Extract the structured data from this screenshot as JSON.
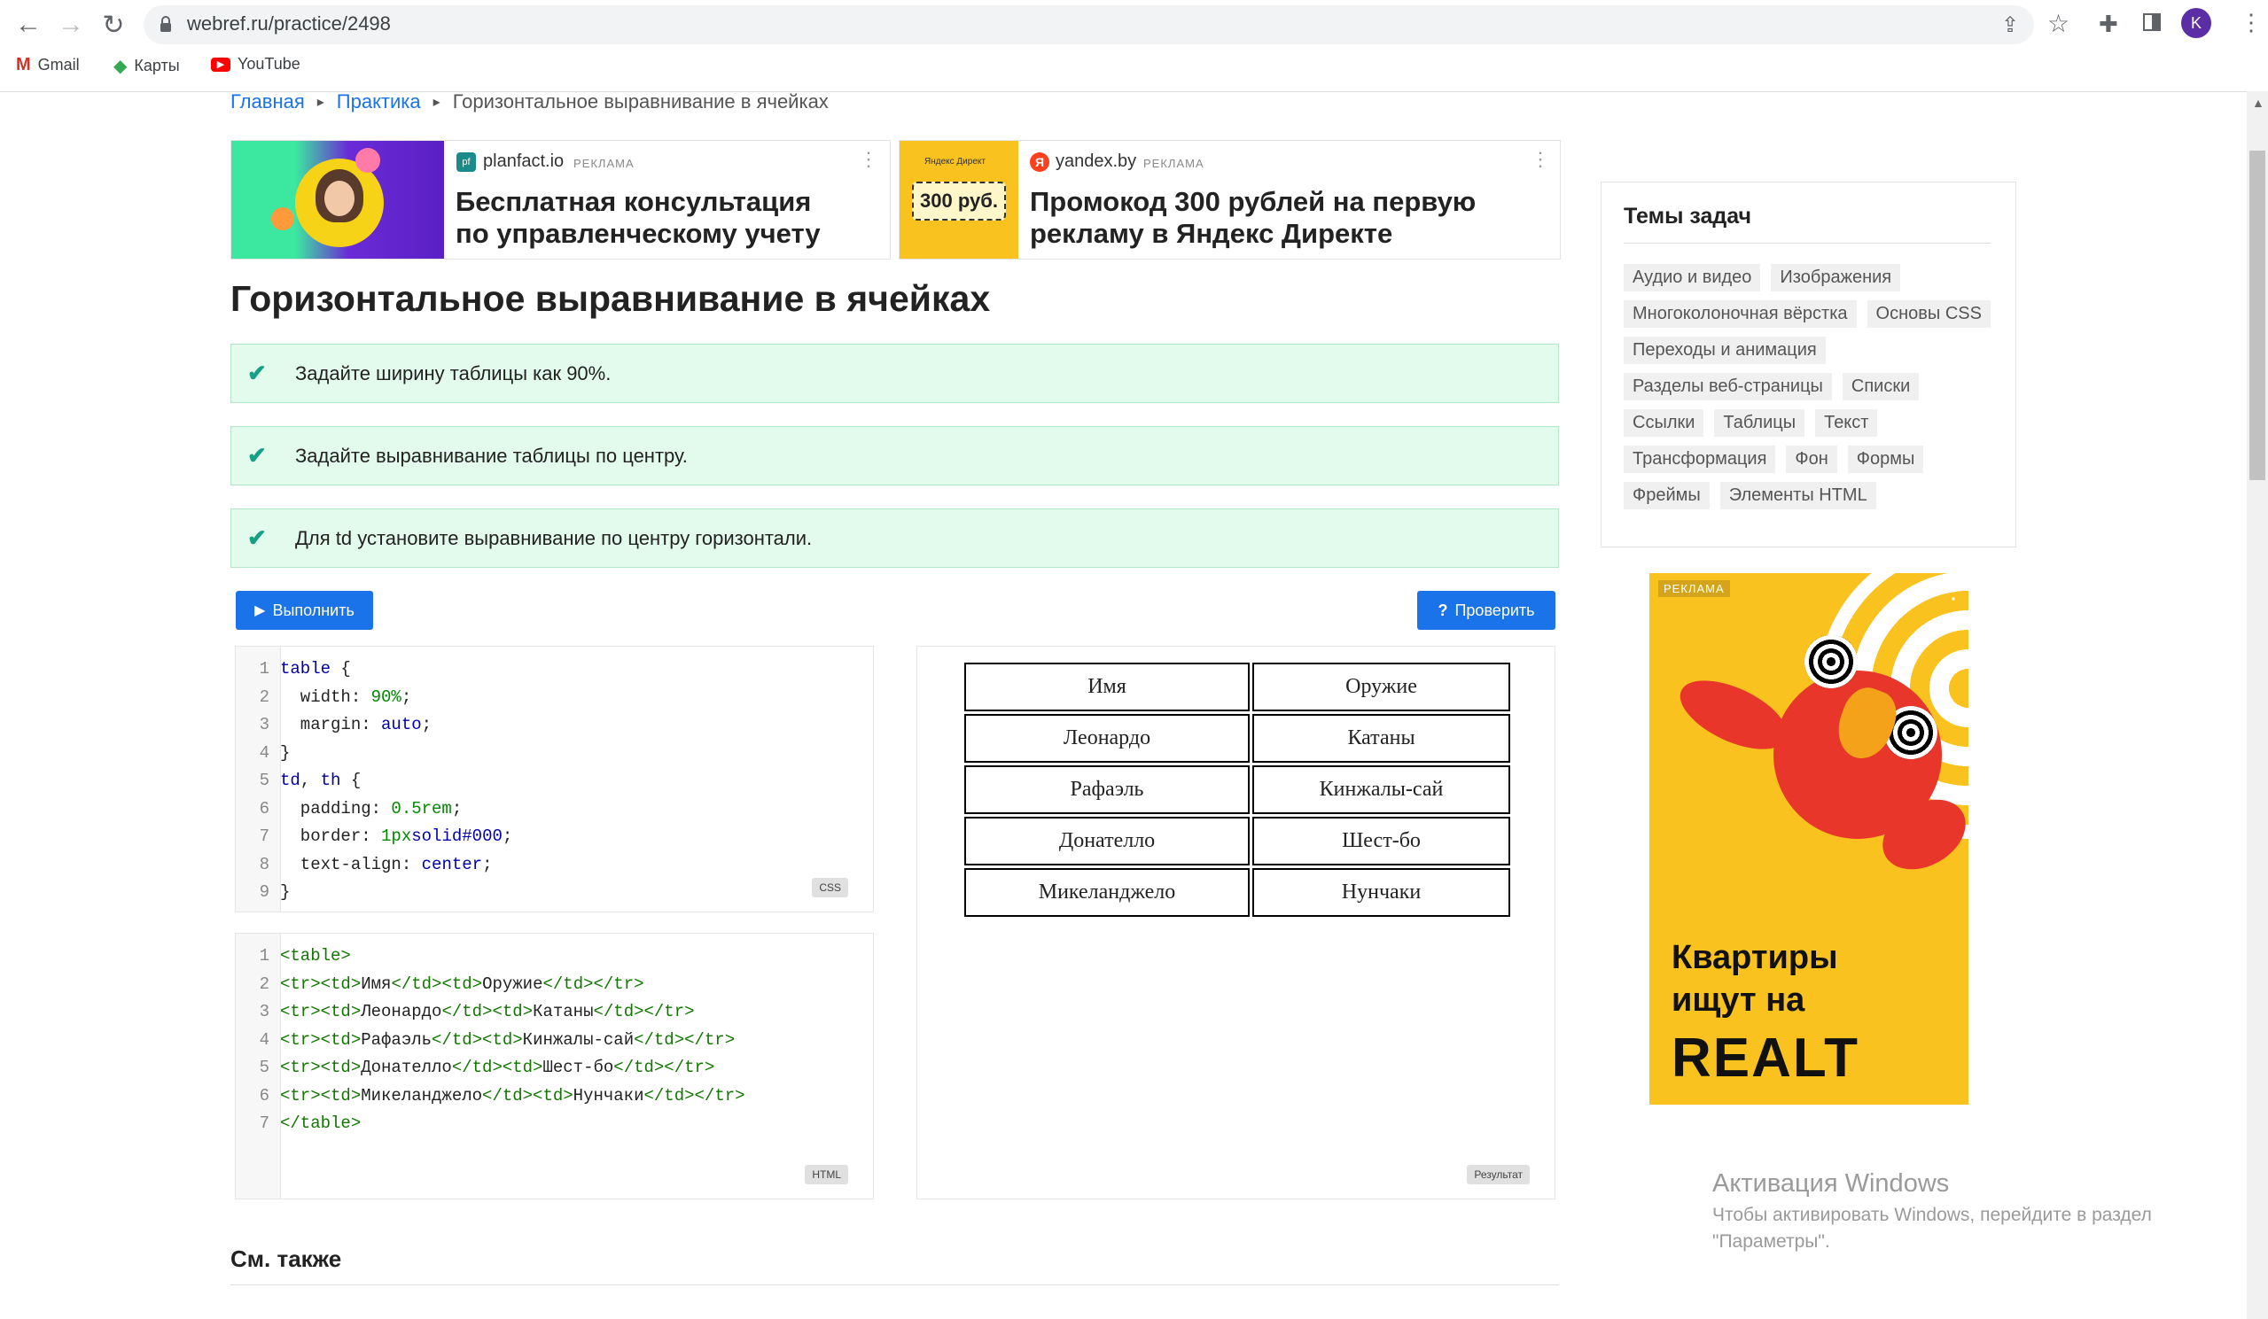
{
  "browser": {
    "url": "webref.ru/practice/2498",
    "bookmarks": [
      "Gmail",
      "Карты",
      "YouTube"
    ],
    "profile_initial": "K"
  },
  "breadcrumb": {
    "home": "Главная",
    "practice": "Практика",
    "current": "Горизонтальное выравнивание в ячейках",
    "separator": "▸"
  },
  "ads": [
    {
      "domain": "planfact.io",
      "label": "РЕКЛАМА",
      "title_line1": "Бесплатная консультация",
      "title_line2": "по управленческому учету"
    },
    {
      "domain": "yandex.by",
      "label": "РЕКЛАМА",
      "title_line1": "Промокод 300 рублей на первую",
      "title_line2": "рекламу в Яндекс Директе",
      "image_text_small": "Яндекс Директ",
      "image_text": "300 руб."
    }
  ],
  "page_title": "Горизонтальное выравнивание в ячейках",
  "tasks": [
    "Задайте ширину таблицы как 90%.",
    "Задайте выравнивание таблицы по центру.",
    "Для td установите выравнивание по центру горизонтали."
  ],
  "buttons": {
    "run": "Выполнить",
    "check": "Проверить"
  },
  "css_badge": "CSS",
  "html_badge": "HTML",
  "result_badge": "Результат",
  "result_table": [
    [
      "Имя",
      "Оружие"
    ],
    [
      "Леонардо",
      "Катаны"
    ],
    [
      "Рафаэль",
      "Кинжалы-сай"
    ],
    [
      "Донателло",
      "Шест-бо"
    ],
    [
      "Микеланджело",
      "Нунчаки"
    ]
  ],
  "see_also": "См. также",
  "sidebar": {
    "title": "Темы задач",
    "topics": [
      "Аудио и видео",
      "Изображения",
      "Многоколоночная вёрстка",
      "Основы CSS",
      "Переходы и анимация",
      "Разделы веб-страницы",
      "Списки",
      "Ссылки",
      "Таблицы",
      "Текст",
      "Трансформация",
      "Фон",
      "Формы",
      "Фреймы",
      "Элементы HTML"
    ]
  },
  "side_ad": {
    "label": "РЕКЛАМА",
    "line1": "Квартиры",
    "line2": "ищут на",
    "brand": "REALT"
  },
  "watermark": {
    "title": "Активация Windows",
    "line1": "Чтобы активировать Windows, перейдите в раздел",
    "line2": "\"Параметры\"."
  },
  "colors": {
    "accent": "#1a73e8",
    "task_bg": "#e3fbec",
    "check": "#16a085",
    "ad_yellow": "#f9c21f"
  }
}
